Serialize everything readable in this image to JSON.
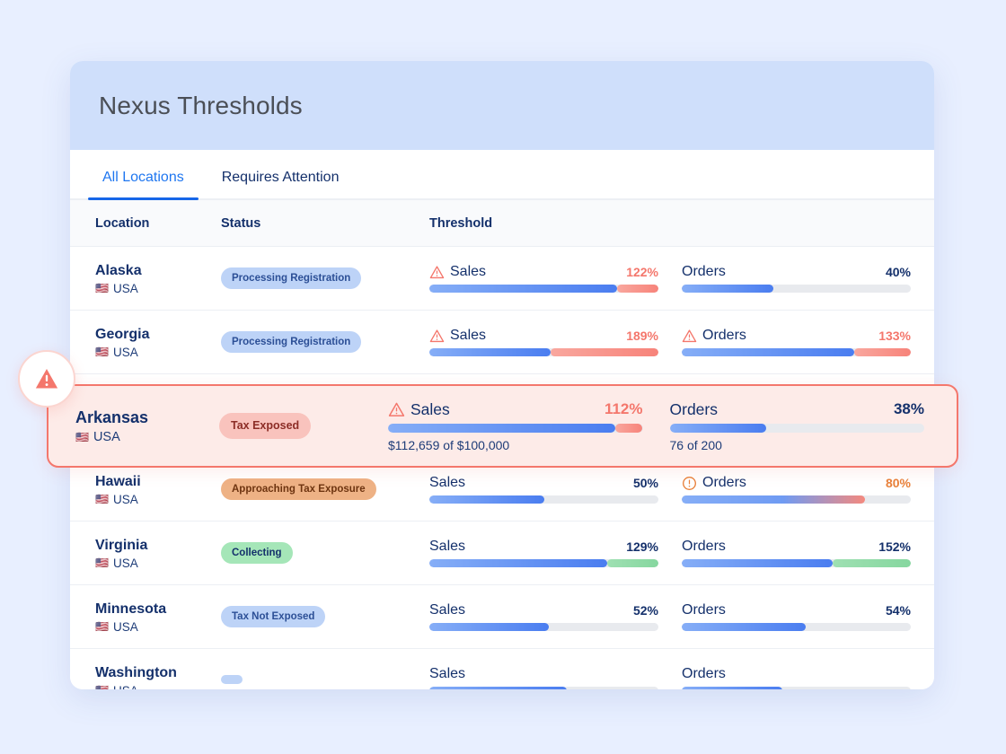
{
  "header": {
    "title": "Nexus Thresholds"
  },
  "tabs": [
    {
      "label": "All Locations",
      "active": true
    },
    {
      "label": "Requires Attention",
      "active": false
    }
  ],
  "table": {
    "columns": {
      "location": "Location",
      "status": "Status",
      "threshold": "Threshold"
    }
  },
  "alert_bubble": {
    "icon": "warning-triangle-icon",
    "color": "#f4776c"
  },
  "colors": {
    "page_background": "#e8efff",
    "card_header": "#cfdffb",
    "accent_blue": "#1666e8",
    "navy_text": "#14306b",
    "over_red": "#f4776c",
    "warn_orange": "#e8813a",
    "good_green": "#86d79f",
    "highlight_bg": "#fdebe8",
    "highlight_border": "#f4776c"
  },
  "rows": [
    {
      "location": "Alaska",
      "country": "USA",
      "flag": "🇺🇸",
      "status": {
        "label": "Processing Registration",
        "style": "badge-blue"
      },
      "metrics": [
        {
          "label": "Sales",
          "percent": "122%",
          "value": 122,
          "state": "over",
          "icon": "warning-triangle-icon",
          "sub": ""
        },
        {
          "label": "Orders",
          "percent": "40%",
          "value": 40,
          "state": "normal",
          "icon": "",
          "sub": ""
        }
      ]
    },
    {
      "location": "Georgia",
      "country": "USA",
      "flag": "🇺🇸",
      "status": {
        "label": "Processing Registration",
        "style": "badge-blue"
      },
      "metrics": [
        {
          "label": "Sales",
          "percent": "189%",
          "value": 189,
          "state": "over",
          "icon": "warning-triangle-icon",
          "sub": ""
        },
        {
          "label": "Orders",
          "percent": "133%",
          "value": 133,
          "state": "over",
          "icon": "warning-triangle-icon",
          "sub": ""
        }
      ]
    },
    {
      "location": "Arkansas",
      "country": "USA",
      "flag": "🇺🇸",
      "highlighted": true,
      "status": {
        "label": "Tax Exposed",
        "style": "badge-salmon"
      },
      "metrics": [
        {
          "label": "Sales",
          "percent": "112%",
          "value": 112,
          "state": "over",
          "icon": "warning-triangle-icon",
          "sub": "$112,659 of $100,000"
        },
        {
          "label": "Orders",
          "percent": "38%",
          "value": 38,
          "state": "normal",
          "icon": "",
          "sub": "76 of 200"
        }
      ]
    },
    {
      "location": "Hawaii",
      "country": "USA",
      "flag": "🇺🇸",
      "status": {
        "label": "Approaching Tax Exposure",
        "style": "badge-orange"
      },
      "metrics": [
        {
          "label": "Sales",
          "percent": "50%",
          "value": 50,
          "state": "normal",
          "icon": "",
          "sub": ""
        },
        {
          "label": "Orders",
          "percent": "80%",
          "value": 80,
          "state": "warn",
          "icon": "alert-circle-icon",
          "sub": ""
        }
      ]
    },
    {
      "location": "Virginia",
      "country": "USA",
      "flag": "🇺🇸",
      "status": {
        "label": "Collecting",
        "style": "badge-green"
      },
      "metrics": [
        {
          "label": "Sales",
          "percent": "129%",
          "value": 129,
          "state": "good",
          "icon": "",
          "sub": ""
        },
        {
          "label": "Orders",
          "percent": "152%",
          "value": 152,
          "state": "good",
          "icon": "",
          "sub": ""
        }
      ]
    },
    {
      "location": "Minnesota",
      "country": "USA",
      "flag": "🇺🇸",
      "status": {
        "label": "Tax Not Exposed",
        "style": "badge-blue"
      },
      "metrics": [
        {
          "label": "Sales",
          "percent": "52%",
          "value": 52,
          "state": "normal",
          "icon": "",
          "sub": ""
        },
        {
          "label": "Orders",
          "percent": "54%",
          "value": 54,
          "state": "normal",
          "icon": "",
          "sub": ""
        }
      ]
    },
    {
      "location": "Washington",
      "country": "USA",
      "flag": "🇺🇸",
      "clipped": true,
      "status": {
        "label": "",
        "style": "badge-blue"
      },
      "metrics": [
        {
          "label": "Sales",
          "percent": "",
          "value": 60,
          "state": "normal",
          "icon": "",
          "sub": ""
        },
        {
          "label": "Orders",
          "percent": "",
          "value": 44,
          "state": "normal",
          "icon": "",
          "sub": ""
        }
      ]
    }
  ]
}
